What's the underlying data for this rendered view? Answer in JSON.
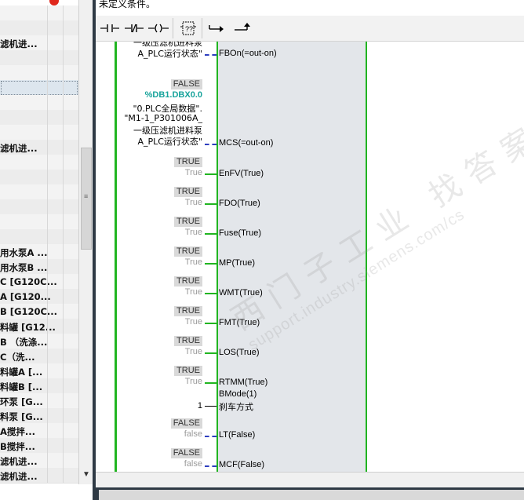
{
  "left_panel": {
    "rows": [
      {
        "label": ""
      },
      {
        "label": ""
      },
      {
        "label": "滤机进..."
      },
      {
        "label": ""
      },
      {
        "label": ""
      },
      {
        "label": ""
      },
      {
        "label": ""
      },
      {
        "label": ""
      },
      {
        "label": ""
      },
      {
        "label": "滤机进..."
      },
      {
        "label": ""
      },
      {
        "label": ""
      },
      {
        "label": ""
      },
      {
        "label": ""
      },
      {
        "label": ""
      },
      {
        "label": ""
      },
      {
        "label": "用水泵A ..."
      },
      {
        "label": "用水泵B ..."
      },
      {
        "label": "C [G120C..."
      },
      {
        "label": "A [G120..."
      },
      {
        "label": "B [G120C..."
      },
      {
        "label": "料罐 [G12..."
      },
      {
        "label": "B （洗涤..."
      },
      {
        "label": "C（洗..."
      },
      {
        "label": "料罐A [..."
      },
      {
        "label": "料罐B [..."
      },
      {
        "label": "环泵 [G..."
      },
      {
        "label": "料泵 [G..."
      },
      {
        "label": "A搅拌..."
      },
      {
        "label": "B搅拌..."
      },
      {
        "label": "滤机进..."
      },
      {
        "label": "滤机进..."
      }
    ],
    "scroll_icon": "drag-grip-icon",
    "scroll_down_icon": "chevron-down-icon"
  },
  "editor": {
    "condition_text": "未定义条件。",
    "toolbar": [
      {
        "name": "no-contact-icon"
      },
      {
        "name": "nc-contact-icon"
      },
      {
        "name": "coil-icon"
      },
      {
        "name": "empty-box-icon"
      },
      {
        "name": "open-branch-icon"
      },
      {
        "name": "close-branch-icon"
      }
    ],
    "network": {
      "top_comment": "A_PLC运行状态\"",
      "top_pin": "FBOn(=out-on)",
      "mcs": {
        "badge": "FALSE",
        "address": "%DB1.DBX0.0",
        "comment_lines": [
          "\"0.PLC全局数据\".",
          "\"M1-1_P301006A_",
          "一级压滤机进料泵",
          "A_PLC运行状态\""
        ],
        "pin": "MCS(=out-on)"
      },
      "pins": [
        {
          "badge": "TRUE",
          "value": "True",
          "label": "EnFV(True)"
        },
        {
          "badge": "TRUE",
          "value": "True",
          "label": "FDO(True)"
        },
        {
          "badge": "TRUE",
          "value": "True",
          "label": "Fuse(True)"
        },
        {
          "badge": "TRUE",
          "value": "True",
          "label": "MP(True)"
        },
        {
          "badge": "TRUE",
          "value": "True",
          "label": "WMT(True)"
        },
        {
          "badge": "TRUE",
          "value": "True",
          "label": "FMT(True)"
        },
        {
          "badge": "TRUE",
          "value": "True",
          "label": "LOS(True)"
        },
        {
          "badge": "TRUE",
          "value": "True",
          "label": "RTMM(True)"
        }
      ],
      "bmode": {
        "value": "1",
        "label": "BMode(1)",
        "sublabel": "刹车方式"
      },
      "false_pins": [
        {
          "badge": "FALSE",
          "value": "false",
          "label": "LT(False)"
        },
        {
          "badge": "FALSE",
          "value": "false",
          "label": "MCF(False)"
        }
      ]
    },
    "watermark": {
      "big": "西门子工业 找答案",
      "small": "support.industry.siemens.com/cs"
    }
  },
  "colors": {
    "rail_green": "#21b521",
    "address_teal": "#17a39b",
    "dashed_blue": "#2d3dbf",
    "fb_body": "#e3e6ea",
    "splitter": "#2f3a45"
  }
}
